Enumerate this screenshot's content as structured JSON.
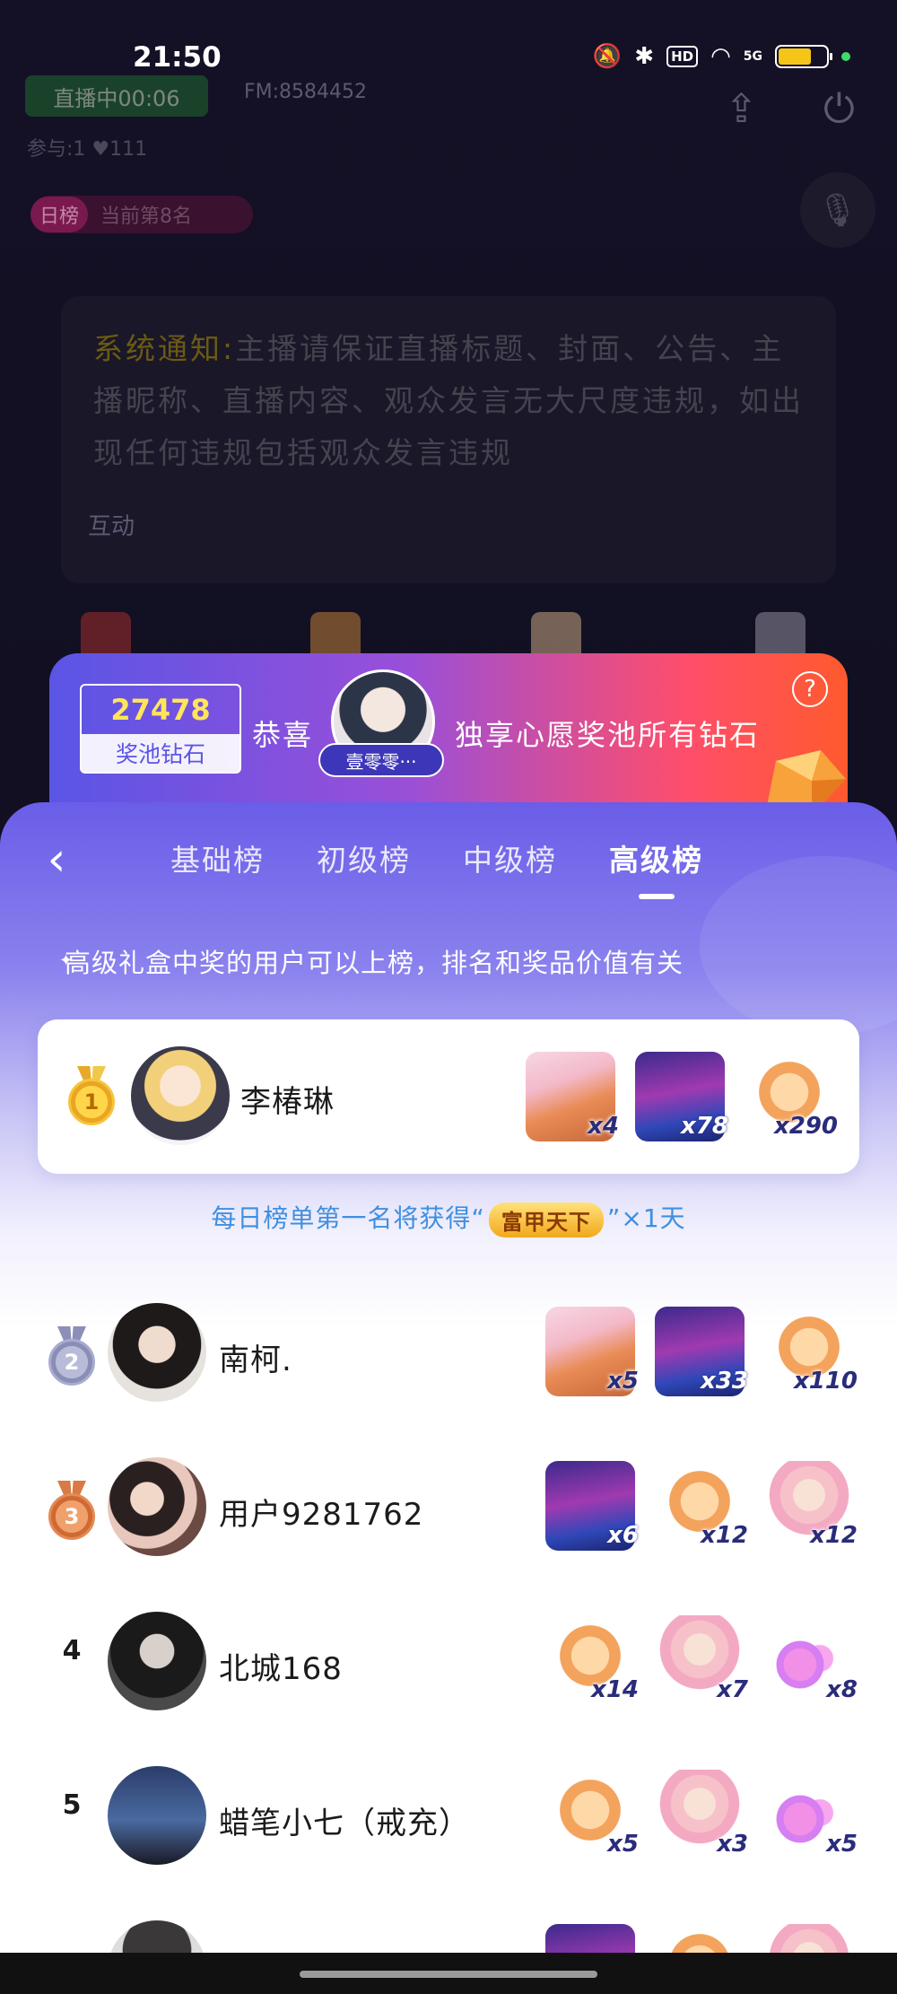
{
  "status_bar": {
    "time": "21:50",
    "icons": [
      "mute-icon",
      "bluetooth-icon",
      "hd-icon",
      "wifi-icon",
      "5g-signal-icon",
      "battery-icon"
    ],
    "hd_label": "HD",
    "network_label": "5G",
    "battery_fraction": 0.7
  },
  "live_room": {
    "live_badge": "直播中00:06",
    "fm_label": "FM:8584452",
    "join_info": "参与:1  ♥111",
    "daily_rank_tag": "日榜",
    "daily_rank_text": "当前第8名",
    "system_notice_label": "系统通知:",
    "system_notice_text": "主播请保证直播标题、封面、公告、主播昵称、直播内容、观众发言无大尺度违规，如出现任何违规包括观众发言违规",
    "interact_label": "互动"
  },
  "prize_pool": {
    "diamonds": "27478",
    "diamonds_label": "奖池钻石",
    "congrats": "恭喜",
    "winner_name": "壹零零···",
    "win_text": "独享心愿奖池所有钻石",
    "help_icon": "?"
  },
  "leaderboard": {
    "tabs": [
      {
        "label": "基础榜",
        "active": false
      },
      {
        "label": "初级榜",
        "active": false
      },
      {
        "label": "中级榜",
        "active": false
      },
      {
        "label": "高级榜",
        "active": true
      }
    ],
    "subtitle": "高级礼盒中奖的用户可以上榜，排名和奖品价值有关",
    "daily_reward_prefix": "每日榜单第一名将获得“",
    "daily_reward_badge": "富甲天下",
    "daily_reward_suffix": "”×1天",
    "entries": [
      {
        "rank": "1",
        "name": "李椿琳",
        "gifts": [
          {
            "type": "fox",
            "count": "x4"
          },
          {
            "type": "dj",
            "count": "x78"
          },
          {
            "type": "cat",
            "count": "x290"
          }
        ]
      },
      {
        "rank": "2",
        "name": "南柯.",
        "gifts": [
          {
            "type": "fox",
            "count": "x5"
          },
          {
            "type": "dj",
            "count": "x33"
          },
          {
            "type": "cat",
            "count": "x110"
          }
        ]
      },
      {
        "rank": "3",
        "name": "用户9281762",
        "gifts": [
          {
            "type": "dj",
            "count": "x6"
          },
          {
            "type": "cat",
            "count": "x12"
          },
          {
            "type": "bear",
            "count": "x12"
          }
        ]
      },
      {
        "rank": "4",
        "name": "北城168",
        "gifts": [
          {
            "type": "cat",
            "count": "x14"
          },
          {
            "type": "bear",
            "count": "x7"
          },
          {
            "type": "heart",
            "count": "x8"
          }
        ]
      },
      {
        "rank": "5",
        "name": "蜡笔小七（戒充）",
        "gifts": [
          {
            "type": "cat",
            "count": "x5"
          },
          {
            "type": "bear",
            "count": "x3"
          },
          {
            "type": "heart",
            "count": "x5"
          }
        ]
      }
    ]
  },
  "colors": {
    "accent_purple": "#6a5de8",
    "pool_gold": "#ffe55a",
    "reward_blue": "#3f8fe0"
  }
}
